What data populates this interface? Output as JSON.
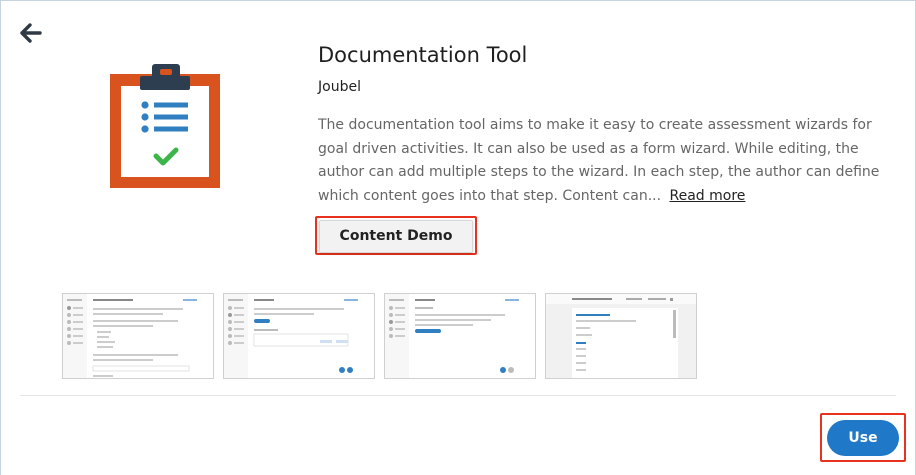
{
  "header": {
    "back_icon": "arrow-left-icon"
  },
  "content": {
    "logo_icon": "clipboard-checklist-icon",
    "title": "Documentation Tool",
    "author": "Joubel",
    "description": "The documentation tool aims to make it easy to create assessment wizards for goal driven activities. It can also be used as a form wizard. While editing, the author can add multiple steps to the wizard. In each step, the author can define which content goes into that step. Content can...",
    "read_more_label": "Read more",
    "demo_button_label": "Content Demo"
  },
  "screenshots_strip": {
    "count": 4
  },
  "footer": {
    "use_button_label": "Use"
  },
  "colors": {
    "accent": "#1f78c8",
    "highlight": "#e8321f",
    "logo_orange": "#d9531e",
    "logo_navy": "#2d3e50",
    "logo_blue": "#2f7fc1",
    "check_green": "#3cb54a"
  }
}
